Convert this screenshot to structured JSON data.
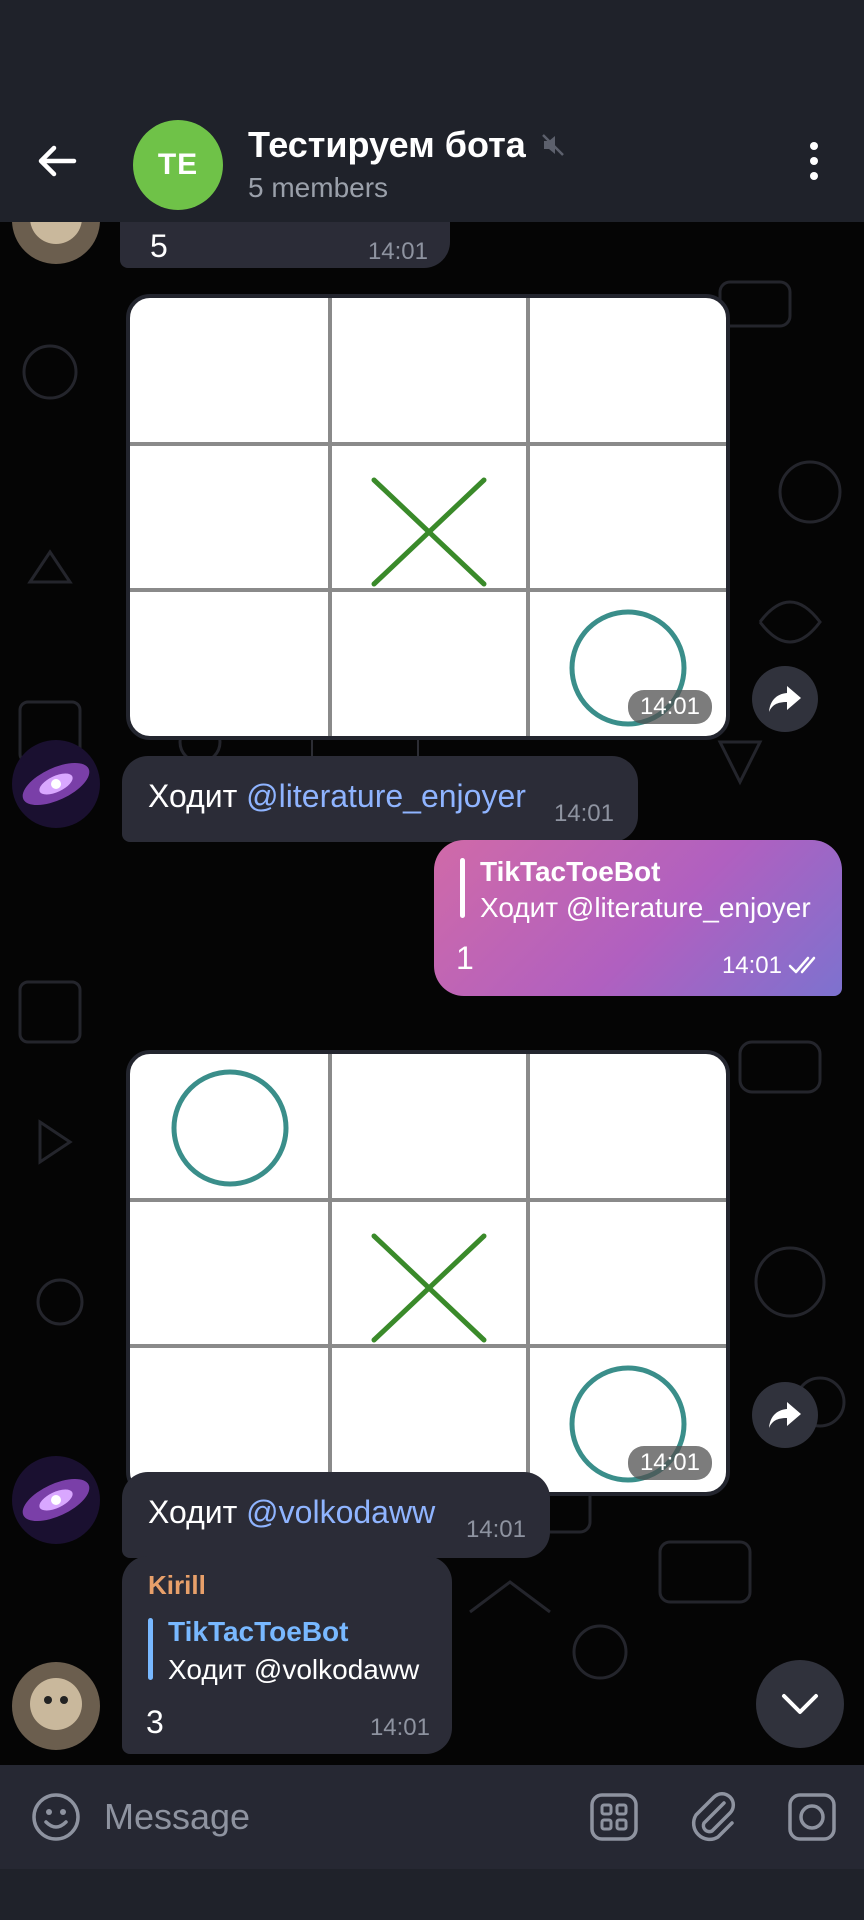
{
  "header": {
    "avatar_initials": "TE",
    "title": "Тестируем бота",
    "subtitle": "5 members"
  },
  "messages": {
    "m1": {
      "text": "5",
      "time": "14:01"
    },
    "board1": {
      "time": "14:01",
      "cells": [
        "",
        "",
        "",
        "",
        "X",
        "",
        "",
        "",
        "O"
      ]
    },
    "m2": {
      "prefix": "Ходит",
      "mention": "@literature_enjoyer",
      "time": "14:01"
    },
    "own": {
      "reply_name": "TikTacToeBot",
      "reply_text": "Ходит @literature_enjoyer",
      "text": "1",
      "time": "14:01"
    },
    "board2": {
      "time": "14:01",
      "cells": [
        "O",
        "",
        "",
        "",
        "X",
        "",
        "",
        "",
        "O"
      ]
    },
    "m3": {
      "prefix": "Ходит",
      "mention": "@volkodaww",
      "time": "14:01"
    },
    "m4": {
      "sender": "Kirill",
      "reply_name": "TikTacToeBot",
      "reply_text": "Ходит @volkodaww",
      "text": "3",
      "time": "14:01"
    }
  },
  "input": {
    "placeholder": "Message"
  },
  "colors": {
    "accent": "#6fc248",
    "x_mark": "#3a8a2a",
    "o_mark": "#3a8e8a",
    "sender_kirill": "#e8a06a",
    "reply_link": "#78b8ff"
  }
}
